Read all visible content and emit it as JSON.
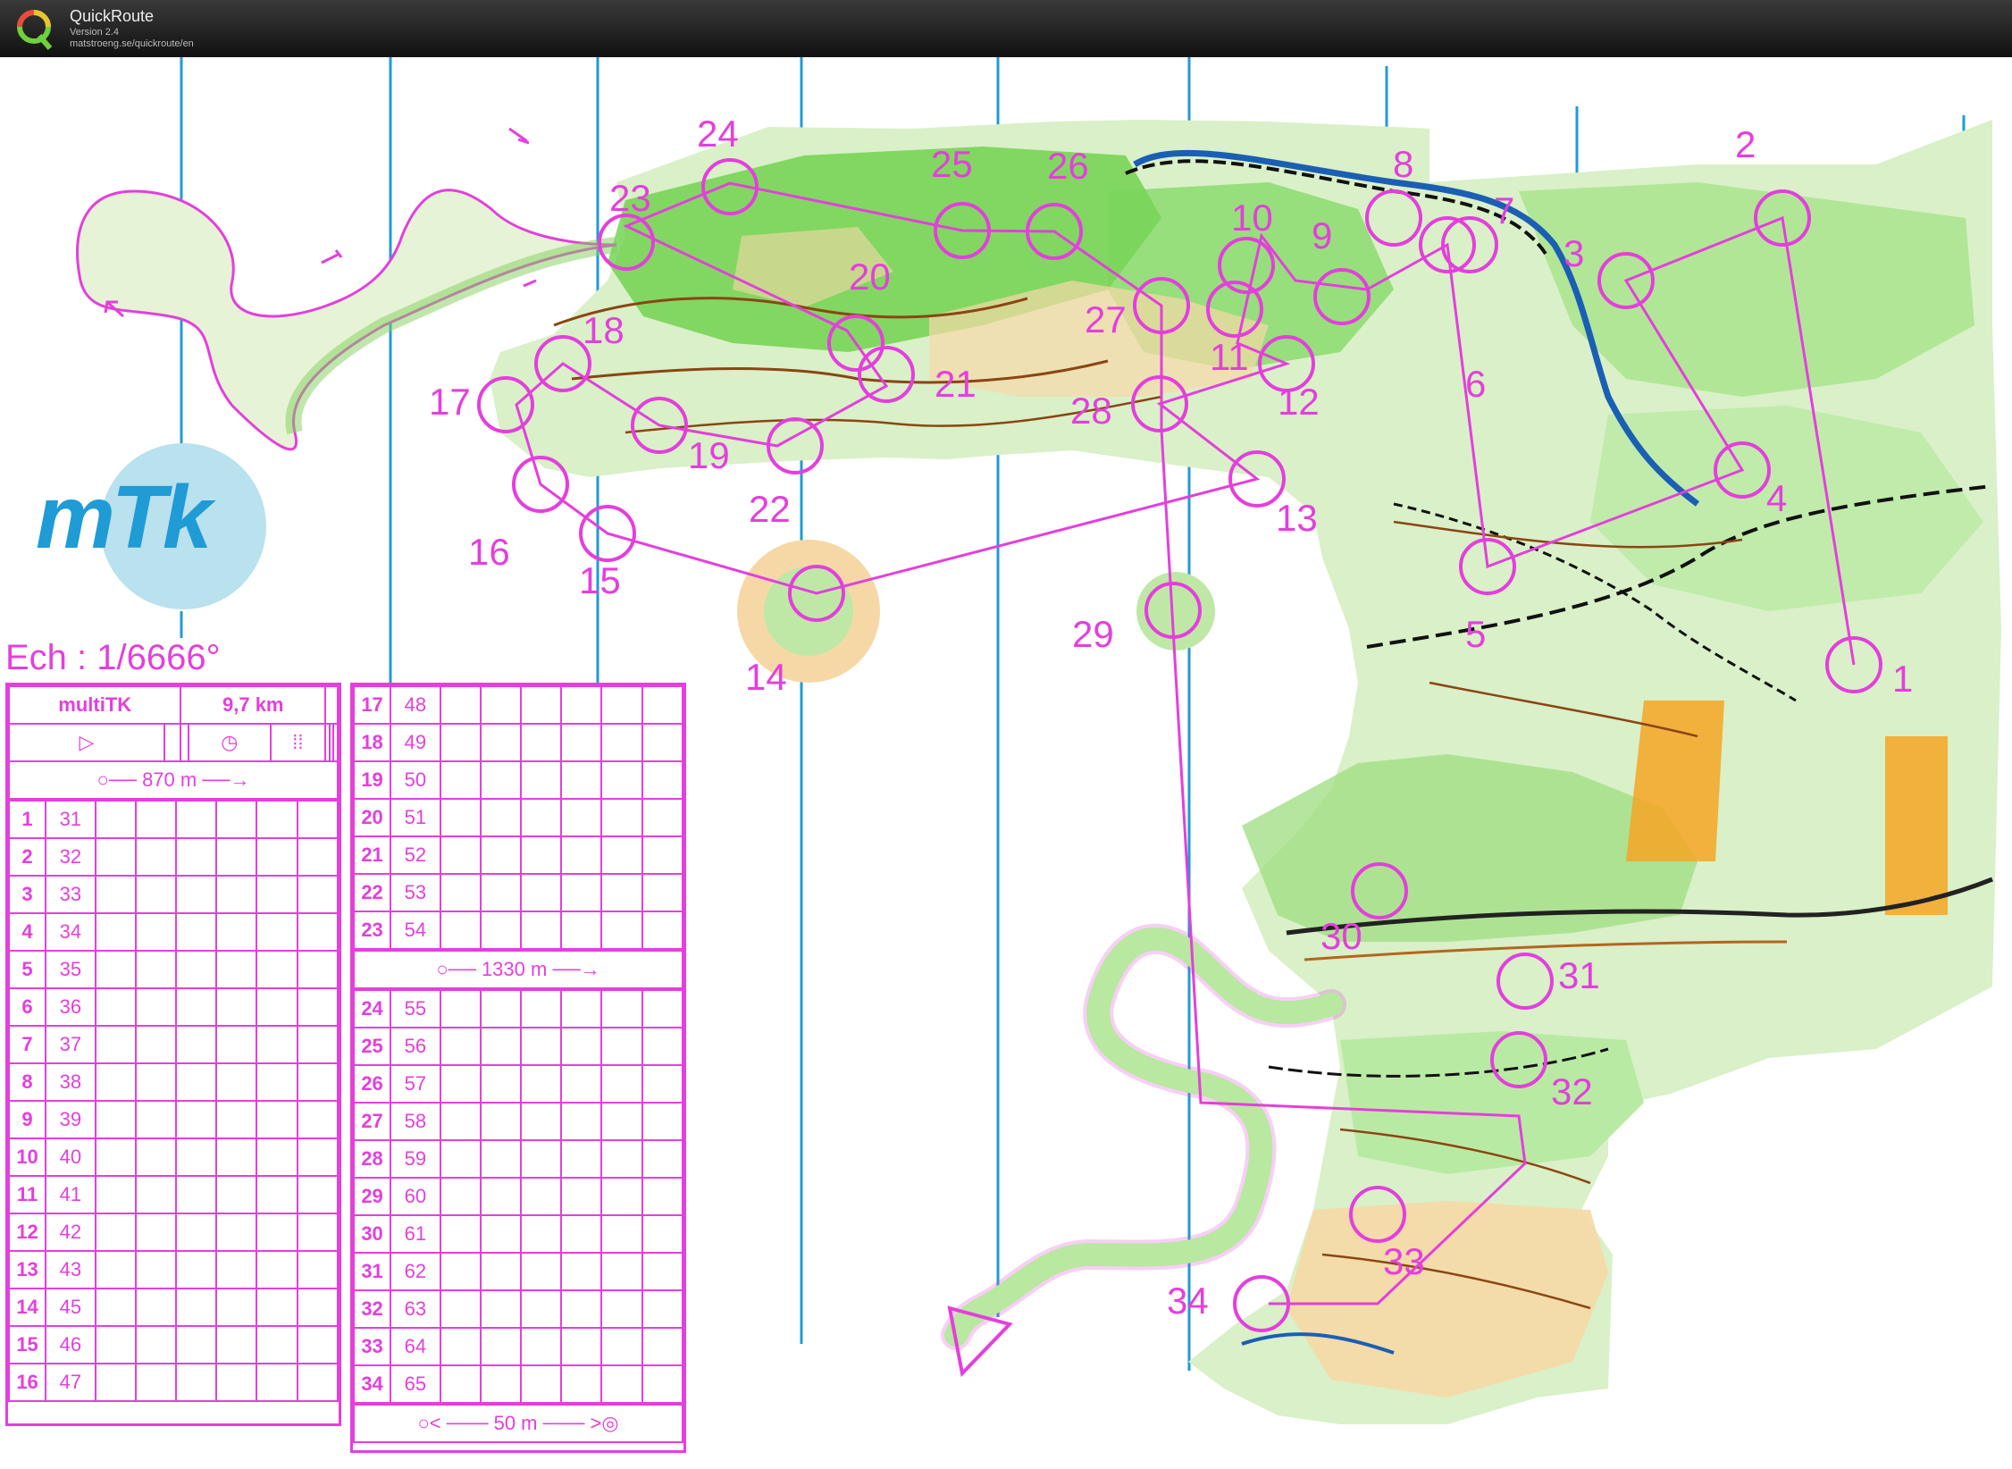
{
  "app": {
    "title": "QuickRoute",
    "version": "Version 2.4",
    "url": "matstroeng.se/quickroute/en"
  },
  "colors": {
    "course": "#e43fdc",
    "meridian": "#1f9bd6",
    "forest_green": "#5ecf3e",
    "open_yellow": "#f7c98d",
    "contour_brown": "#a0522d"
  },
  "map": {
    "logo_text": "mTk",
    "scale_text": "Ech : 1/6666°",
    "control_numbers": [
      "1",
      "2",
      "3",
      "4",
      "5",
      "6",
      "7",
      "8",
      "9",
      "10",
      "11",
      "12",
      "13",
      "14",
      "15",
      "16",
      "17",
      "18",
      "19",
      "20",
      "21",
      "22",
      "23",
      "24",
      "25",
      "26",
      "27",
      "28",
      "29",
      "30",
      "31",
      "32",
      "33",
      "34"
    ]
  },
  "description_left": {
    "event": "multiTK",
    "distance": "9,7 km",
    "start_distance": "870 m",
    "rows": [
      {
        "n": "1",
        "code": "31"
      },
      {
        "n": "2",
        "code": "32"
      },
      {
        "n": "3",
        "code": "33"
      },
      {
        "n": "4",
        "code": "34"
      },
      {
        "n": "5",
        "code": "35"
      },
      {
        "n": "6",
        "code": "36"
      },
      {
        "n": "7",
        "code": "37"
      },
      {
        "n": "8",
        "code": "38"
      },
      {
        "n": "9",
        "code": "39"
      },
      {
        "n": "10",
        "code": "40"
      },
      {
        "n": "11",
        "code": "41"
      },
      {
        "n": "12",
        "code": "42"
      },
      {
        "n": "13",
        "code": "43"
      },
      {
        "n": "14",
        "code": "45"
      },
      {
        "n": "15",
        "code": "46"
      },
      {
        "n": "16",
        "code": "47"
      }
    ]
  },
  "description_right": {
    "rows_a": [
      {
        "n": "17",
        "code": "48"
      },
      {
        "n": "18",
        "code": "49"
      },
      {
        "n": "19",
        "code": "50"
      },
      {
        "n": "20",
        "code": "51"
      },
      {
        "n": "21",
        "code": "52"
      },
      {
        "n": "22",
        "code": "53"
      },
      {
        "n": "23",
        "code": "54"
      }
    ],
    "mid_distance": "1330 m",
    "rows_b": [
      {
        "n": "24",
        "code": "55"
      },
      {
        "n": "25",
        "code": "56"
      },
      {
        "n": "26",
        "code": "57"
      },
      {
        "n": "27",
        "code": "58"
      },
      {
        "n": "28",
        "code": "59"
      },
      {
        "n": "29",
        "code": "60"
      },
      {
        "n": "30",
        "code": "61"
      },
      {
        "n": "31",
        "code": "62"
      },
      {
        "n": "32",
        "code": "63"
      },
      {
        "n": "33",
        "code": "64"
      },
      {
        "n": "34",
        "code": "65"
      }
    ],
    "finish_distance": "50 m"
  }
}
